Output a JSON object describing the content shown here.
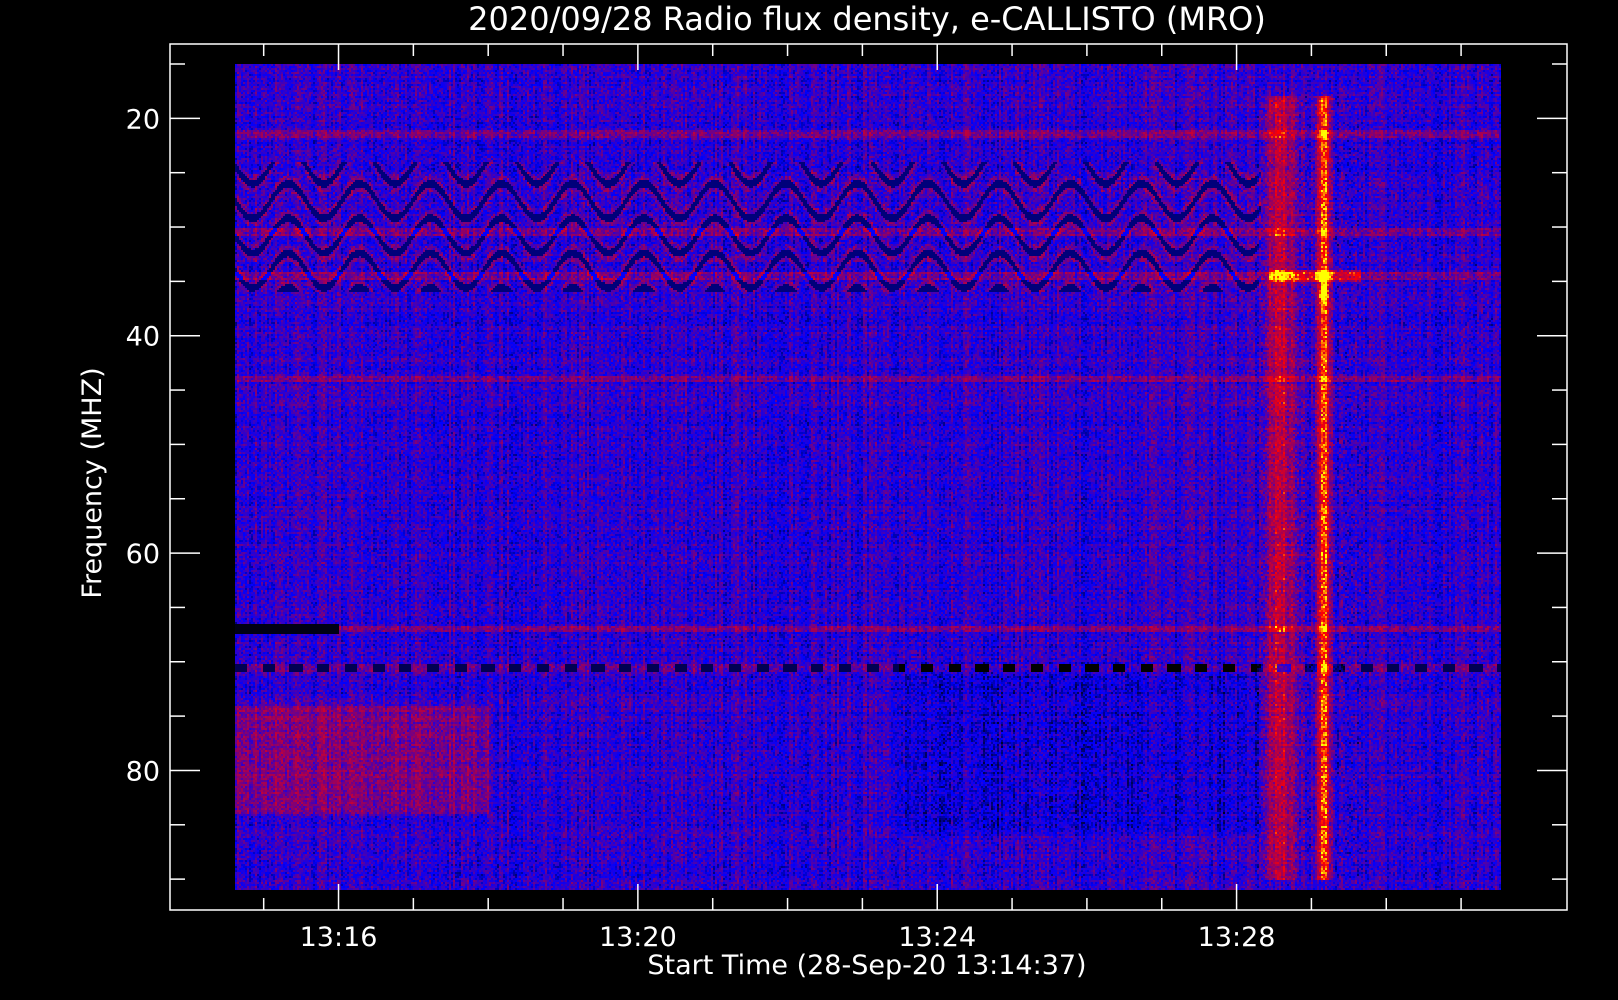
{
  "chart_data": {
    "type": "heatmap",
    "title": "2020/09/28  Radio flux density, e-CALLISTO (MRO)",
    "xlabel": "Start Time (28-Sep-20 13:14:37)",
    "ylabel": "Frequency (MHZ)",
    "x_axis": {
      "range": [
        "13:14:37",
        "13:31:32"
      ],
      "major_ticks": [
        "13:16",
        "13:20",
        "13:24",
        "13:28"
      ],
      "minor_tick_interval_min": 1
    },
    "y_axis": {
      "range": [
        15,
        91
      ],
      "inverted": true,
      "major_ticks": [
        20,
        40,
        60,
        80
      ],
      "minor_tick_interval": 5
    },
    "colormap": [
      "#000000",
      "#0000ff",
      "#ff0000",
      "#ffff00"
    ],
    "features": {
      "burst": {
        "time_range": [
          "13:28:20",
          "13:29:40"
        ],
        "freq_range": [
          18,
          90
        ],
        "brightest_time": "13:29:10",
        "brightest_freq": 36
      },
      "interference_bands_mhz": [
        21.5,
        30.5,
        34.5,
        44,
        67,
        70.5
      ],
      "dark_segment": {
        "time_range": [
          "13:14:37",
          "13:16:00"
        ],
        "freq": 67
      },
      "enhanced_low_freq_region": {
        "time_range": [
          "13:14:37",
          "13:18:00"
        ],
        "freq_range": [
          74,
          84
        ]
      }
    }
  }
}
